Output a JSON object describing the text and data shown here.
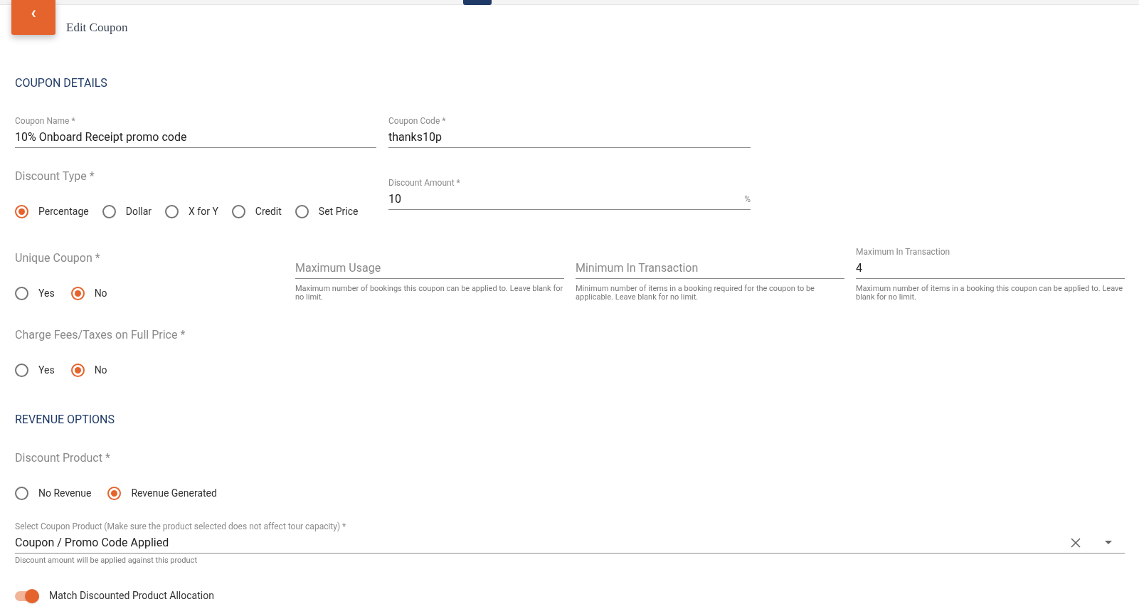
{
  "header": {
    "back_icon": "‹",
    "title": "Edit Coupon"
  },
  "coupon_details": {
    "heading": "COUPON DETAILS",
    "coupon_name": {
      "label": "Coupon Name *",
      "value": "10% Onboard Receipt promo code"
    },
    "coupon_code": {
      "label": "Coupon Code *",
      "value": "thanks10p"
    },
    "discount_type": {
      "label": "Discount Type *",
      "options": [
        {
          "label": "Percentage",
          "selected": true
        },
        {
          "label": "Dollar",
          "selected": false
        },
        {
          "label": "X for Y",
          "selected": false
        },
        {
          "label": "Credit",
          "selected": false
        },
        {
          "label": "Set Price",
          "selected": false
        }
      ]
    },
    "discount_amount": {
      "label": "Discount Amount *",
      "value": "10",
      "suffix": "%"
    },
    "unique_coupon": {
      "label": "Unique Coupon *",
      "options": [
        {
          "label": "Yes",
          "selected": false
        },
        {
          "label": "No",
          "selected": true
        }
      ]
    },
    "limit_fields": [
      {
        "label": "Maximum Usage",
        "helper": "Maximum number of bookings this coupon can be applied to. Leave blank for no limit."
      },
      {
        "label": "Minimum In Transaction",
        "helper": "Minimum number of items in a booking required for the coupon to be applicable. Leave blank for no limit."
      },
      {
        "label": "Maximum In Transaction",
        "value": "4",
        "helper": "Maximum number of items in a booking this coupon can be applied to. Leave blank for no limit."
      }
    ],
    "charge_fees": {
      "label": "Charge Fees/Taxes on Full Price *",
      "options": [
        {
          "label": "Yes",
          "selected": false
        },
        {
          "label": "No",
          "selected": true
        }
      ]
    }
  },
  "revenue_options": {
    "heading": "REVENUE OPTIONS",
    "discount_product": {
      "label": "Discount Product *",
      "options": [
        {
          "label": "No Revenue",
          "selected": false
        },
        {
          "label": "Revenue Generated",
          "selected": true
        }
      ]
    },
    "coupon_product": {
      "label": "Select Coupon Product (Make sure the product selected does not affect tour capacity) *",
      "value": "Coupon / Promo Code Applied",
      "helper": "Discount amount will be applied against this product"
    },
    "match_allocation": {
      "label": "Match Discounted Product Allocation",
      "on": true
    }
  }
}
